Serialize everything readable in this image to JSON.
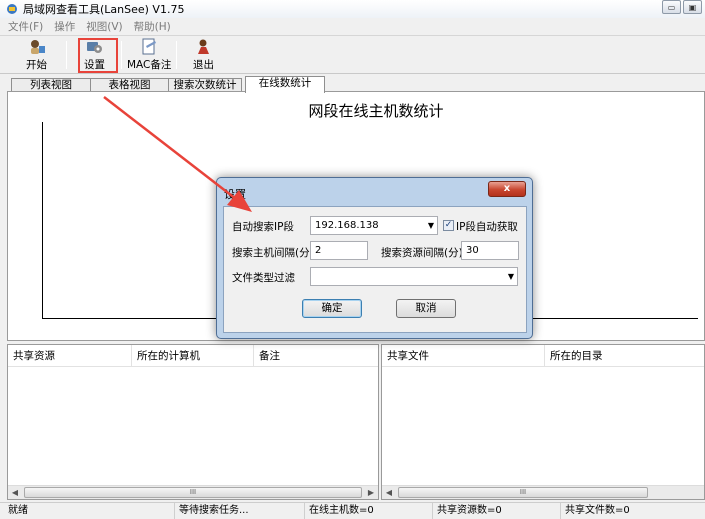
{
  "window": {
    "title": "局域网查看工具(LanSee) V1.75",
    "controls": [
      "minimize",
      "maximize"
    ]
  },
  "menu": [
    "文件(F)",
    "操作",
    "视图(V)",
    "帮助(H)"
  ],
  "toolbar": [
    {
      "label": "开始",
      "icon": "start-icon"
    },
    {
      "label": "设置",
      "icon": "settings-icon"
    },
    {
      "label": "MAC备注",
      "icon": "mac-note-icon"
    },
    {
      "label": "退出",
      "icon": "exit-icon"
    }
  ],
  "tabs": [
    {
      "label": "列表视图",
      "active": false
    },
    {
      "label": "表格视图",
      "active": false
    },
    {
      "label": "搜索次数统计",
      "active": false
    },
    {
      "label": "在线数统计",
      "active": true
    }
  ],
  "chart": {
    "title": "网段在线主机数统计"
  },
  "left_list": {
    "columns": [
      "共享资源",
      "所在的计算机",
      "备注"
    ]
  },
  "right_list": {
    "columns": [
      "共享文件",
      "所在的目录"
    ]
  },
  "scroll_thumb": "III",
  "status": [
    "就绪",
    "等待搜索任务...",
    "在线主机数=0",
    "共享资源数=0",
    "共享文件数=0"
  ],
  "dialog": {
    "title": "设置",
    "close_label": "x",
    "ip_label": "自动搜索IP段",
    "ip_value": "192.168.138",
    "auto_ip_label": "IP段自动获取",
    "auto_ip_checked": "✓",
    "host_interval_label": "搜索主机间隔(分)",
    "host_interval_value": "2",
    "res_interval_label": "搜索资源间隔(分)",
    "res_interval_value": "30",
    "filter_label": "文件类型过滤",
    "filter_value": "",
    "ok_label": "确定",
    "cancel_label": "取消"
  },
  "annotation_color": "#e8433a"
}
